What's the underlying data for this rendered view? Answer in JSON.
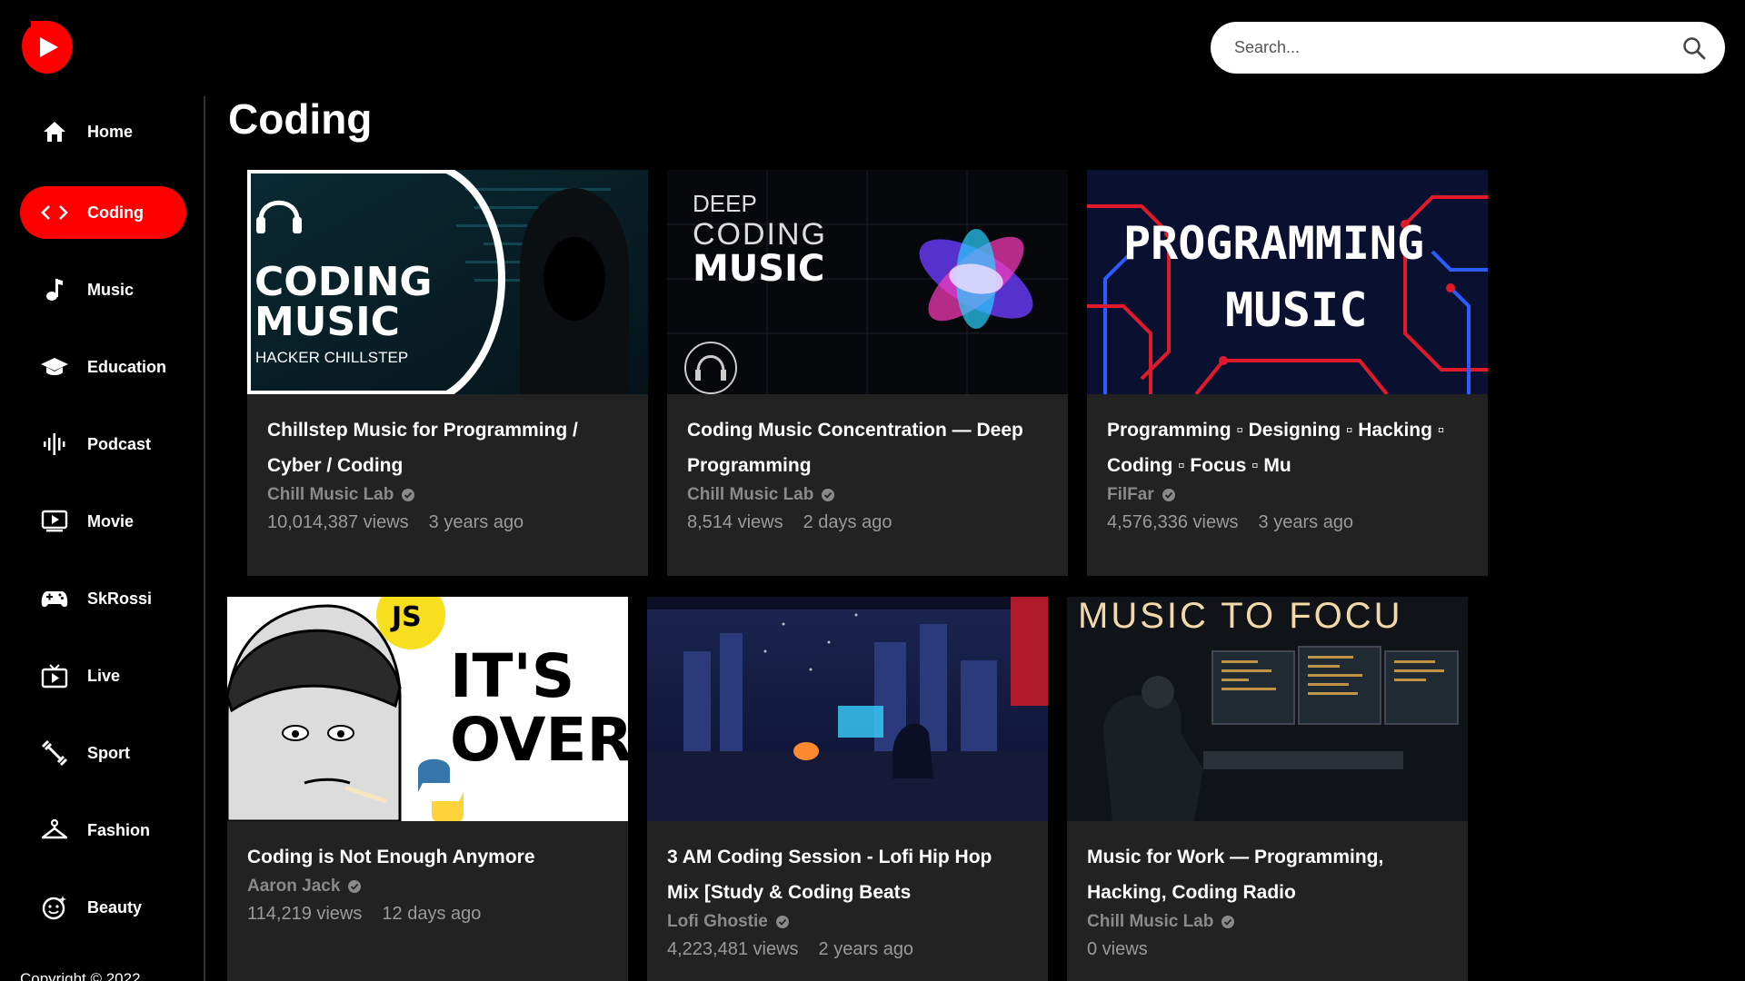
{
  "search": {
    "placeholder": "Search..."
  },
  "sidebar": {
    "items": [
      {
        "label": "Home",
        "icon": "home-icon"
      },
      {
        "label": "Coding",
        "icon": "code-icon",
        "active": true
      },
      {
        "label": "Music",
        "icon": "music-note-icon"
      },
      {
        "label": "Education",
        "icon": "graduation-cap-icon"
      },
      {
        "label": "Podcast",
        "icon": "podcast-waveform-icon"
      },
      {
        "label": "Movie",
        "icon": "movie-play-icon"
      },
      {
        "label": "SkRossi",
        "icon": "gamepad-icon"
      },
      {
        "label": "Live",
        "icon": "live-tv-icon"
      },
      {
        "label": "Sport",
        "icon": "fitness-icon"
      },
      {
        "label": "Fashion",
        "icon": "hanger-icon"
      },
      {
        "label": "Beauty",
        "icon": "face-icon"
      }
    ],
    "copyright": "Copyright © 2022"
  },
  "main": {
    "title": "Coding",
    "videos": [
      {
        "title": "Chillstep Music for Programming / Cyber / Coding",
        "channel": "Chill Music Lab",
        "views": "10,014,387 views",
        "age": "3 years ago",
        "thumb": {
          "line1": "CODING",
          "line2": "MUSIC",
          "sub": "HACKER CHILLSTEP"
        }
      },
      {
        "title": "Coding Music Concentration — Deep Programming",
        "channel": "Chill Music Lab",
        "views": "8,514 views",
        "age": "2 days ago",
        "thumb": {
          "line1": "DEEP",
          "line2": "CODING",
          "line3": "MUSIC"
        }
      },
      {
        "title": "Programming ▫ Designing ▫ Hacking ▫ Coding ▫ Focus ▫ Mu",
        "channel": "FilFar",
        "views": "4,576,336 views",
        "age": "3 years ago",
        "thumb": {
          "line1": "PROGRAMMING",
          "line2": "MUSIC"
        }
      },
      {
        "title": "Coding is Not Enough Anymore",
        "channel": "Aaron Jack",
        "views": "114,219 views",
        "age": "12 days ago",
        "thumb": {
          "line1": "IT'S",
          "line2": "OVER",
          "badge": "JS"
        }
      },
      {
        "title": "3 AM Coding Session - Lofi Hip Hop Mix [Study & Coding Beats",
        "channel": "Lofi Ghostie",
        "views": "4,223,481 views",
        "age": "2 years ago",
        "thumb": {}
      },
      {
        "title": "Music for Work — Programming, Hacking, Coding Radio",
        "channel": "Chill Music Lab",
        "views": "0 views",
        "age": "",
        "thumb": {
          "line1": "MUSIC TO FOCU"
        }
      }
    ]
  },
  "colors": {
    "accent": "#ff0000",
    "card_bg": "#222222",
    "meta": "#9a9a9a"
  }
}
